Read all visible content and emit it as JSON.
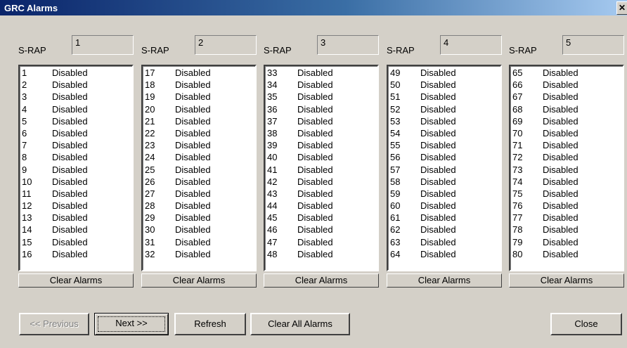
{
  "window": {
    "title": "GRC Alarms",
    "close_glyph": "✕"
  },
  "groups": [
    {
      "label": "S-RAP",
      "value": "1",
      "clear_label": "Clear Alarms",
      "rows": [
        [
          "1",
          "Disabled"
        ],
        [
          "2",
          "Disabled"
        ],
        [
          "3",
          "Disabled"
        ],
        [
          "4",
          "Disabled"
        ],
        [
          "5",
          "Disabled"
        ],
        [
          "6",
          "Disabled"
        ],
        [
          "7",
          "Disabled"
        ],
        [
          "8",
          "Disabled"
        ],
        [
          "9",
          "Disabled"
        ],
        [
          "10",
          "Disabled"
        ],
        [
          "11",
          "Disabled"
        ],
        [
          "12",
          "Disabled"
        ],
        [
          "13",
          "Disabled"
        ],
        [
          "14",
          "Disabled"
        ],
        [
          "15",
          "Disabled"
        ],
        [
          "16",
          "Disabled"
        ]
      ]
    },
    {
      "label": "S-RAP",
      "value": "2",
      "clear_label": "Clear Alarms",
      "rows": [
        [
          "17",
          "Disabled"
        ],
        [
          "18",
          "Disabled"
        ],
        [
          "19",
          "Disabled"
        ],
        [
          "20",
          "Disabled"
        ],
        [
          "21",
          "Disabled"
        ],
        [
          "22",
          "Disabled"
        ],
        [
          "23",
          "Disabled"
        ],
        [
          "24",
          "Disabled"
        ],
        [
          "25",
          "Disabled"
        ],
        [
          "26",
          "Disabled"
        ],
        [
          "27",
          "Disabled"
        ],
        [
          "28",
          "Disabled"
        ],
        [
          "29",
          "Disabled"
        ],
        [
          "30",
          "Disabled"
        ],
        [
          "31",
          "Disabled"
        ],
        [
          "32",
          "Disabled"
        ]
      ]
    },
    {
      "label": "S-RAP",
      "value": "3",
      "clear_label": "Clear Alarms",
      "rows": [
        [
          "33",
          "Disabled"
        ],
        [
          "34",
          "Disabled"
        ],
        [
          "35",
          "Disabled"
        ],
        [
          "36",
          "Disabled"
        ],
        [
          "37",
          "Disabled"
        ],
        [
          "38",
          "Disabled"
        ],
        [
          "39",
          "Disabled"
        ],
        [
          "40",
          "Disabled"
        ],
        [
          "41",
          "Disabled"
        ],
        [
          "42",
          "Disabled"
        ],
        [
          "43",
          "Disabled"
        ],
        [
          "44",
          "Disabled"
        ],
        [
          "45",
          "Disabled"
        ],
        [
          "46",
          "Disabled"
        ],
        [
          "47",
          "Disabled"
        ],
        [
          "48",
          "Disabled"
        ]
      ]
    },
    {
      "label": "S-RAP",
      "value": "4",
      "clear_label": "Clear Alarms",
      "rows": [
        [
          "49",
          "Disabled"
        ],
        [
          "50",
          "Disabled"
        ],
        [
          "51",
          "Disabled"
        ],
        [
          "52",
          "Disabled"
        ],
        [
          "53",
          "Disabled"
        ],
        [
          "54",
          "Disabled"
        ],
        [
          "55",
          "Disabled"
        ],
        [
          "56",
          "Disabled"
        ],
        [
          "57",
          "Disabled"
        ],
        [
          "58",
          "Disabled"
        ],
        [
          "59",
          "Disabled"
        ],
        [
          "60",
          "Disabled"
        ],
        [
          "61",
          "Disabled"
        ],
        [
          "62",
          "Disabled"
        ],
        [
          "63",
          "Disabled"
        ],
        [
          "64",
          "Disabled"
        ]
      ]
    },
    {
      "label": "S-RAP",
      "value": "5",
      "clear_label": "Clear Alarms",
      "rows": [
        [
          "65",
          "Disabled"
        ],
        [
          "66",
          "Disabled"
        ],
        [
          "67",
          "Disabled"
        ],
        [
          "68",
          "Disabled"
        ],
        [
          "69",
          "Disabled"
        ],
        [
          "70",
          "Disabled"
        ],
        [
          "71",
          "Disabled"
        ],
        [
          "72",
          "Disabled"
        ],
        [
          "73",
          "Disabled"
        ],
        [
          "74",
          "Disabled"
        ],
        [
          "75",
          "Disabled"
        ],
        [
          "76",
          "Disabled"
        ],
        [
          "77",
          "Disabled"
        ],
        [
          "78",
          "Disabled"
        ],
        [
          "79",
          "Disabled"
        ],
        [
          "80",
          "Disabled"
        ]
      ]
    }
  ],
  "buttons": {
    "previous": "<< Previous",
    "next": "Next >>",
    "refresh": "Refresh",
    "clear_all": "Clear All Alarms",
    "close": "Close"
  }
}
